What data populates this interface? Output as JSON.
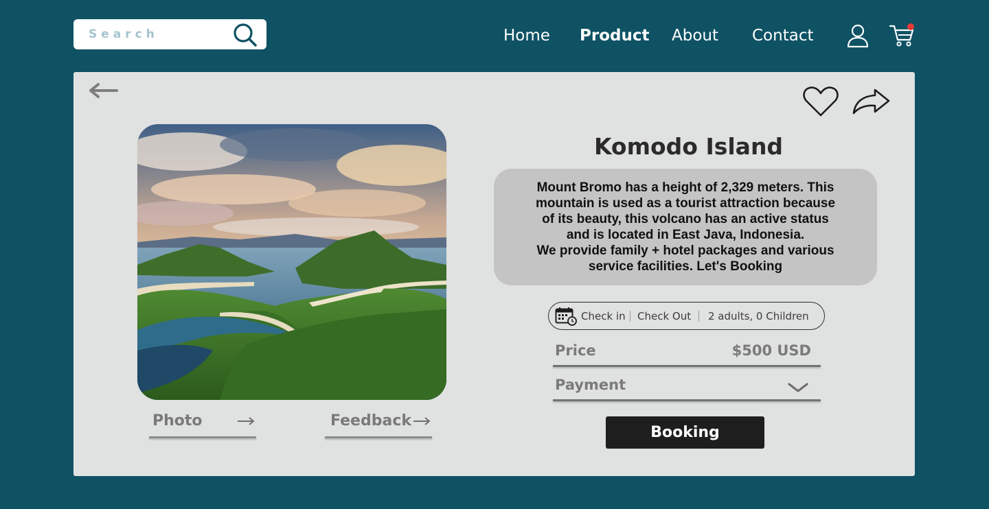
{
  "header": {
    "search": {
      "placeholder": "Search",
      "value": ""
    },
    "nav": [
      {
        "label": "Home",
        "active": false
      },
      {
        "label": "Product",
        "active": true
      },
      {
        "label": "About",
        "active": false
      },
      {
        "label": "Contact",
        "active": false
      }
    ],
    "icons": {
      "search": "search-icon",
      "user": "user-icon",
      "cart": "cart-icon",
      "cart_badge_color": "#e53935"
    }
  },
  "product": {
    "title": "Komodo Island",
    "description": [
      "Mount Bromo has a height of 2,329 meters. This",
      "mountain is used as a tourist attraction because",
      "of its beauty, this volcano has an active status",
      "and is located in East Java, Indonesia.",
      "We provide family + hotel packages and various",
      "service facilities. Let's Booking"
    ],
    "photo_tab": "Photo",
    "feedback_tab": "Feedback",
    "booking_info": {
      "check_in": "Check in",
      "check_out": "Check Out",
      "guests": "2 adults, 0 Children"
    },
    "price_label": "Price",
    "price_value": "$500 USD",
    "payment_label": "Payment",
    "booking_button": "Booking"
  },
  "colors": {
    "background": "#0e5264",
    "card": "#e0e1e1",
    "description_bg": "#c4c4c4",
    "button": "#1e1e1e"
  }
}
